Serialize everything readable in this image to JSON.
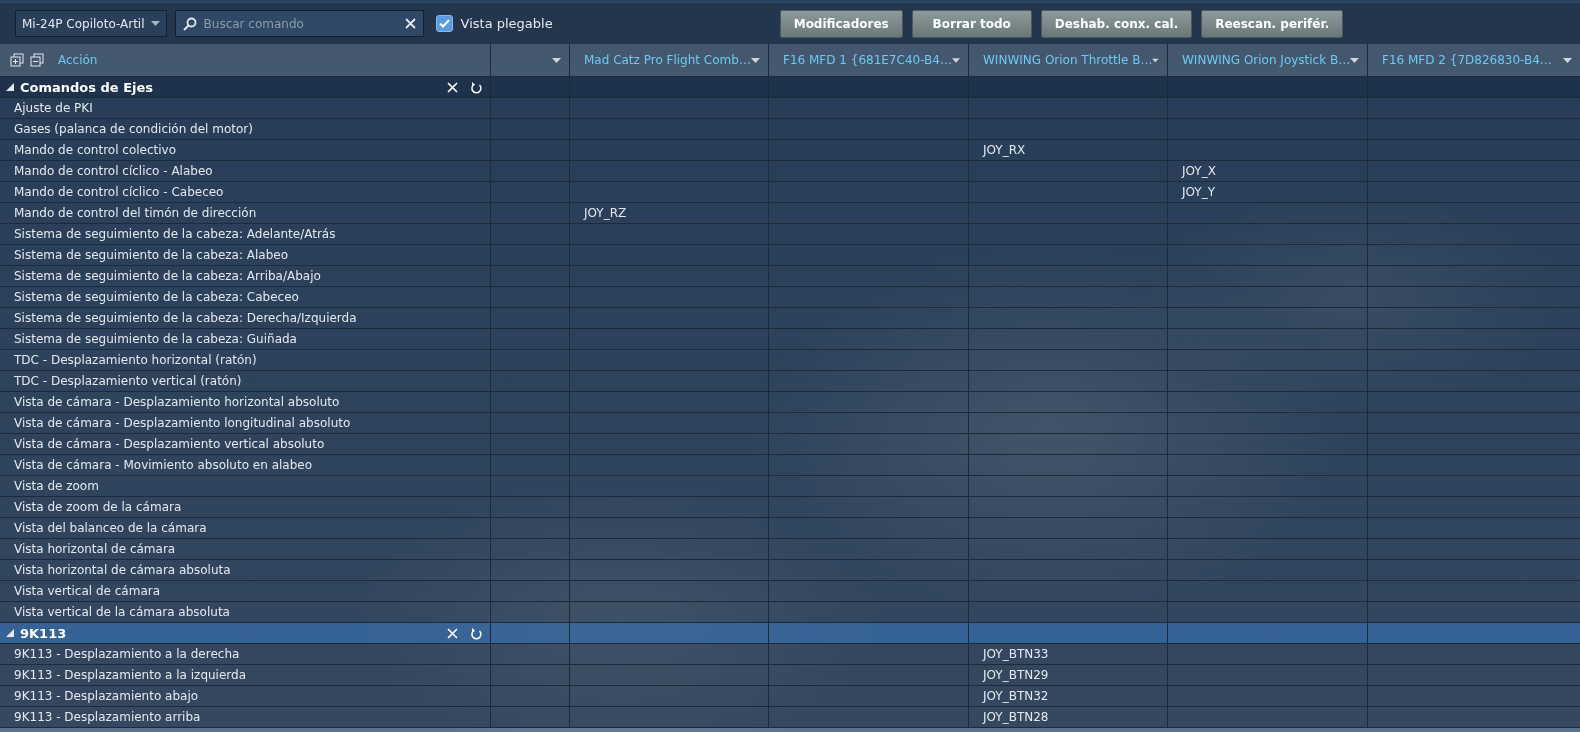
{
  "toolbar": {
    "profile": "Mi-24P Copiloto-Artil",
    "search": {
      "placeholder": "Buscar comando"
    },
    "collapsible_view": {
      "label": "Vista plegable",
      "checked": true
    },
    "buttons": [
      "Modificadores",
      "Borrar todo",
      "Deshab. conx. cal.",
      "Reescan. perifér."
    ]
  },
  "table": {
    "action_header": "Acción",
    "columns": [
      "Mad Catz Pro Flight Comb…",
      "F16 MFD 1 {681E7C40-B4…",
      "WINWING Orion Throttle B…",
      "WINWING Orion Joystick B…",
      "F16 MFD 2 {7D826830-B4…"
    ],
    "groups": [
      {
        "title": "Comandos de Ejes",
        "expanded": true,
        "selected": false,
        "rows": [
          {
            "action": "Ajuste de PKI"
          },
          {
            "action": "Gases (palanca de condición del motor)"
          },
          {
            "action": "Mando de control colectivo",
            "bindings": {
              "column_4": "JOY_RX"
            }
          },
          {
            "action": "Mando de control cíclico - Alabeo",
            "bindings": {
              "column_5": "JOY_X"
            }
          },
          {
            "action": "Mando de control cíclico - Cabeceo",
            "bindings": {
              "column_5": "JOY_Y"
            }
          },
          {
            "action": "Mando de control del timón de dirección",
            "bindings": {
              "column_2": "JOY_RZ"
            }
          },
          {
            "action": "Sistema de seguimiento de la cabeza: Adelante/Atrás"
          },
          {
            "action": "Sistema de seguimiento de la cabeza: Alabeo"
          },
          {
            "action": "Sistema de seguimiento de la cabeza: Arriba/Abajo"
          },
          {
            "action": "Sistema de seguimiento de la cabeza: Cabeceo"
          },
          {
            "action": "Sistema de seguimiento de la cabeza: Derecha/Izquierda"
          },
          {
            "action": "Sistema de seguimiento de la cabeza: Guiñada"
          },
          {
            "action": "TDC - Desplazamiento horizontal (ratón)"
          },
          {
            "action": "TDC - Desplazamiento vertical (ratón)"
          },
          {
            "action": "Vista de cámara - Desplazamiento horizontal absoluto"
          },
          {
            "action": "Vista de cámara - Desplazamiento longitudinal absoluto"
          },
          {
            "action": "Vista de cámara - Desplazamiento vertical absoluto"
          },
          {
            "action": "Vista de cámara - Movimiento absoluto en alabeo"
          },
          {
            "action": "Vista de zoom"
          },
          {
            "action": "Vista de zoom de la cámara"
          },
          {
            "action": "Vista del balanceo de la cámara"
          },
          {
            "action": "Vista horizontal de cámara"
          },
          {
            "action": "Vista horizontal de cámara absoluta"
          },
          {
            "action": "Vista vertical de cámara"
          },
          {
            "action": "Vista vertical de la cámara absoluta"
          }
        ]
      },
      {
        "title": "9K113",
        "expanded": true,
        "selected": true,
        "rows": [
          {
            "action": "9K113 - Desplazamiento a la derecha",
            "bindings": {
              "column_4": "JOY_BTN33"
            }
          },
          {
            "action": "9K113 - Desplazamiento a la izquierda",
            "bindings": {
              "column_4": "JOY_BTN29"
            }
          },
          {
            "action": "9K113 - Desplazamiento abajo",
            "bindings": {
              "column_4": "JOY_BTN32"
            }
          },
          {
            "action": "9K113 - Desplazamiento arriba",
            "bindings": {
              "column_4": "JOY_BTN28"
            }
          }
        ]
      }
    ]
  }
}
